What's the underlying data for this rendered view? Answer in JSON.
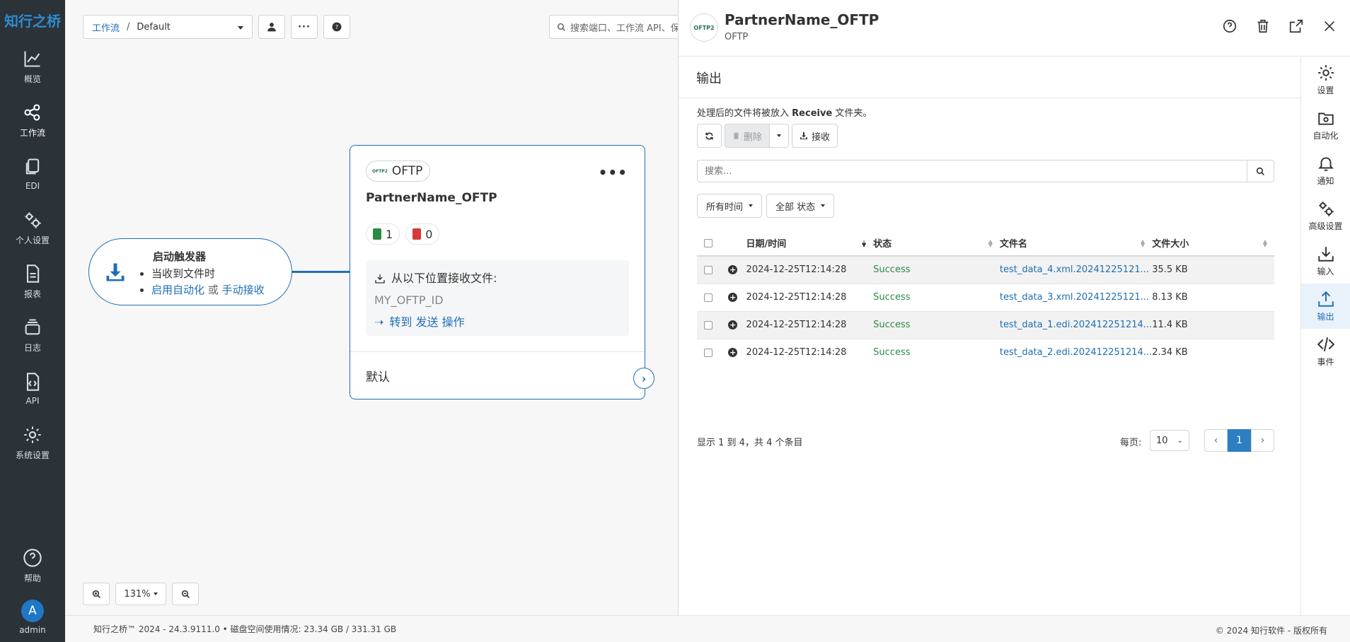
{
  "brand": "知行之桥",
  "nav": {
    "items": [
      {
        "label": "概览",
        "icon": "chart-line-icon"
      },
      {
        "label": "工作流",
        "icon": "workflow-icon"
      },
      {
        "label": "EDI",
        "icon": "copy-icon"
      },
      {
        "label": "个人设置",
        "icon": "gears-icon"
      },
      {
        "label": "报表",
        "icon": "document-icon"
      },
      {
        "label": "日志",
        "icon": "layers-icon"
      },
      {
        "label": "API",
        "icon": "code-file-icon"
      },
      {
        "label": "系统设置",
        "icon": "gear-icon"
      }
    ],
    "help_label": "帮助",
    "user_initial": "A",
    "user_name": "admin"
  },
  "canvas": {
    "breadcrumb_link": "工作流",
    "breadcrumb_sep": "/",
    "breadcrumb_current": "Default",
    "search_placeholder": "搜索端口、工作流 API、保",
    "trigger": {
      "title": "启动触发器",
      "line1": "当收到文件时",
      "link1": "启用自动化",
      "or": "或",
      "link2": "手动接收"
    },
    "node": {
      "type_logo": "OFTP2",
      "type": "OFTP",
      "name": "PartnerName_OFTP",
      "success_count": "1",
      "error_count": "0",
      "receive_label": "从以下位置接收文件:",
      "receive_id": "MY_OFTP_ID",
      "goto_link": "转到 发送 操作",
      "default_label": "默认"
    },
    "zoom_level": "131%"
  },
  "footer": {
    "left": "知行之桥™ 2024 - 24.3.9111.0  •  磁盘空间使用情况:  23.34 GB / 331.31 GB",
    "right": "© 2024 知行软件 - 版权所有"
  },
  "panel": {
    "logo": "OFTP2",
    "title": "PartnerName_OFTP",
    "subtitle": "OFTP",
    "section_title": "输出",
    "desc_before": "处理后的文件将被放入",
    "desc_folder": "Receive",
    "desc_after": "文件夹。",
    "delete_label": "删除",
    "receive_label": "接收",
    "search_placeholder": "搜索...",
    "filter_time": "所有时间",
    "filter_status": "全部 状态",
    "columns": [
      "日期/时间",
      "状态",
      "文件名",
      "文件大小"
    ],
    "rows": [
      {
        "datetime": "2024-12-25T12:14:28",
        "status": "Success",
        "filename": "test_data_4.xml.20241225121...",
        "size": "35.5 KB"
      },
      {
        "datetime": "2024-12-25T12:14:28",
        "status": "Success",
        "filename": "test_data_3.xml.20241225121...",
        "size": "8.13 KB"
      },
      {
        "datetime": "2024-12-25T12:14:28",
        "status": "Success",
        "filename": "test_data_1.edi.202412251214...",
        "size": "11.4 KB"
      },
      {
        "datetime": "2024-12-25T12:14:28",
        "status": "Success",
        "filename": "test_data_2.edi.202412251214...",
        "size": "2.34 KB"
      }
    ],
    "pager_info": "显示 1 到 4，共 4 个条目",
    "per_page_label": "每页:",
    "per_page_value": "10",
    "current_page": "1"
  },
  "right_tabs": [
    {
      "label": "设置",
      "icon": "gear-icon"
    },
    {
      "label": "自动化",
      "icon": "folder-gear-icon"
    },
    {
      "label": "通知",
      "icon": "bell-icon"
    },
    {
      "label": "高级设置",
      "icon": "gears-icon"
    },
    {
      "label": "输入",
      "icon": "download-icon"
    },
    {
      "label": "输出",
      "icon": "upload-icon"
    },
    {
      "label": "事件",
      "icon": "code-icon"
    }
  ],
  "colors": {
    "accent": "#1f6fb5",
    "nav_bg": "#2b3238",
    "success": "#2a8a45",
    "error": "#d33a3a"
  }
}
